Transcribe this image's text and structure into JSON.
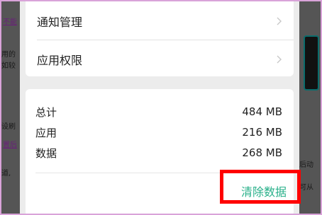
{
  "app_list": {
    "notification_label": "通知管理",
    "permission_label": "应用权限"
  },
  "storage": {
    "rows": [
      {
        "label": "总计",
        "value": "484 MB"
      },
      {
        "label": "应用",
        "value": "216 MB"
      },
      {
        "label": "数据",
        "value": "268 MB"
      }
    ],
    "clear_label": "清除数据"
  },
  "background": {
    "fragments": [
      "不能",
      "用的",
      "如较",
      "设刷",
      "置后",
      "道,"
    ],
    "right_fragments": [
      "后动",
      "可从"
    ]
  },
  "colors": {
    "accent": "#29b08a",
    "highlight": "#ff0000"
  }
}
